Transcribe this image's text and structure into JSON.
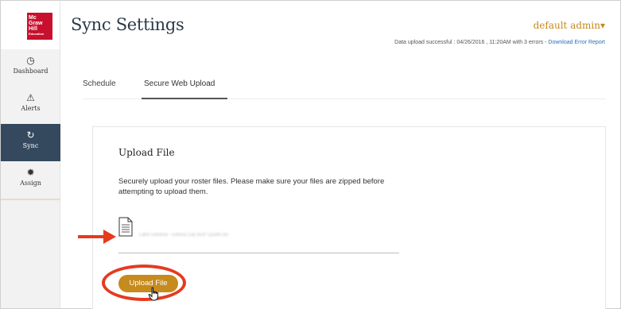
{
  "header": {
    "logo_lines": [
      "Mc",
      "Graw",
      "Hill",
      "Education"
    ],
    "title": "Sync Settings",
    "user_menu": "default admin",
    "user_menu_caret": "▾",
    "status_text": "Data upload successful : 04/26/2016 , 11:20AM with 3 errors - ",
    "status_link": "Download Error Report"
  },
  "sidebar": {
    "items": [
      {
        "label": "Dashboard",
        "icon": "clock-icon",
        "glyph": "◷"
      },
      {
        "label": "Alerts",
        "icon": "warning-icon",
        "glyph": "⚠"
      },
      {
        "label": "Sync",
        "icon": "sync-icon",
        "glyph": "↻",
        "active": true
      },
      {
        "label": "Assign",
        "icon": "gear-icon",
        "glyph": "✹"
      }
    ]
  },
  "tabs": [
    {
      "label": "Schedule",
      "selected": false
    },
    {
      "label": "Secure Web Upload",
      "selected": true
    }
  ],
  "upload": {
    "title": "Upload File",
    "description": "Securely upload your roster files. Please make sure your files are zipped before attempting to upload them.",
    "filename": "Lake Geneva - Genoa City BUP Quote.xls",
    "button_label": "Upload File"
  },
  "colors": {
    "brand_red": "#c8102e",
    "accent_gold": "#c68a1d",
    "sidebar_active": "#34495e",
    "annotation_red": "#e63a1f",
    "link_blue": "#2a6ebb"
  }
}
